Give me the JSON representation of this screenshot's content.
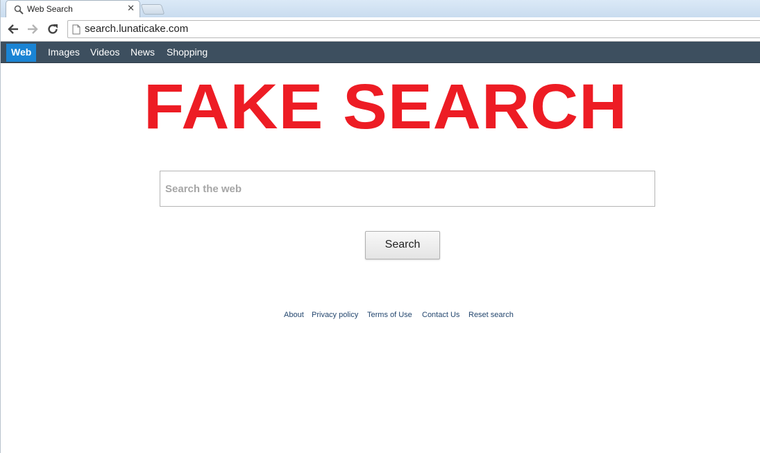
{
  "browser": {
    "tab": {
      "title": "Web Search",
      "close": "✕"
    },
    "address_bar": {
      "url": "search.lunaticake.com"
    }
  },
  "site_nav": {
    "items": [
      {
        "label": "Web",
        "active": true
      },
      {
        "label": "Images"
      },
      {
        "label": "Videos"
      },
      {
        "label": "News"
      },
      {
        "label": "Shopping"
      }
    ]
  },
  "banner": {
    "text": "FAKE SEARCH",
    "color": "#ed1c24"
  },
  "search": {
    "placeholder": "Search the web",
    "value": "",
    "button_label": "Search"
  },
  "footer": {
    "links": [
      "About",
      "Privacy policy",
      "Terms of Use",
      "Contact Us",
      "Reset search"
    ]
  },
  "colors": {
    "nav_background": "#3d4f5f",
    "nav_active": "#1a84d4",
    "footer_link": "#23466e"
  }
}
